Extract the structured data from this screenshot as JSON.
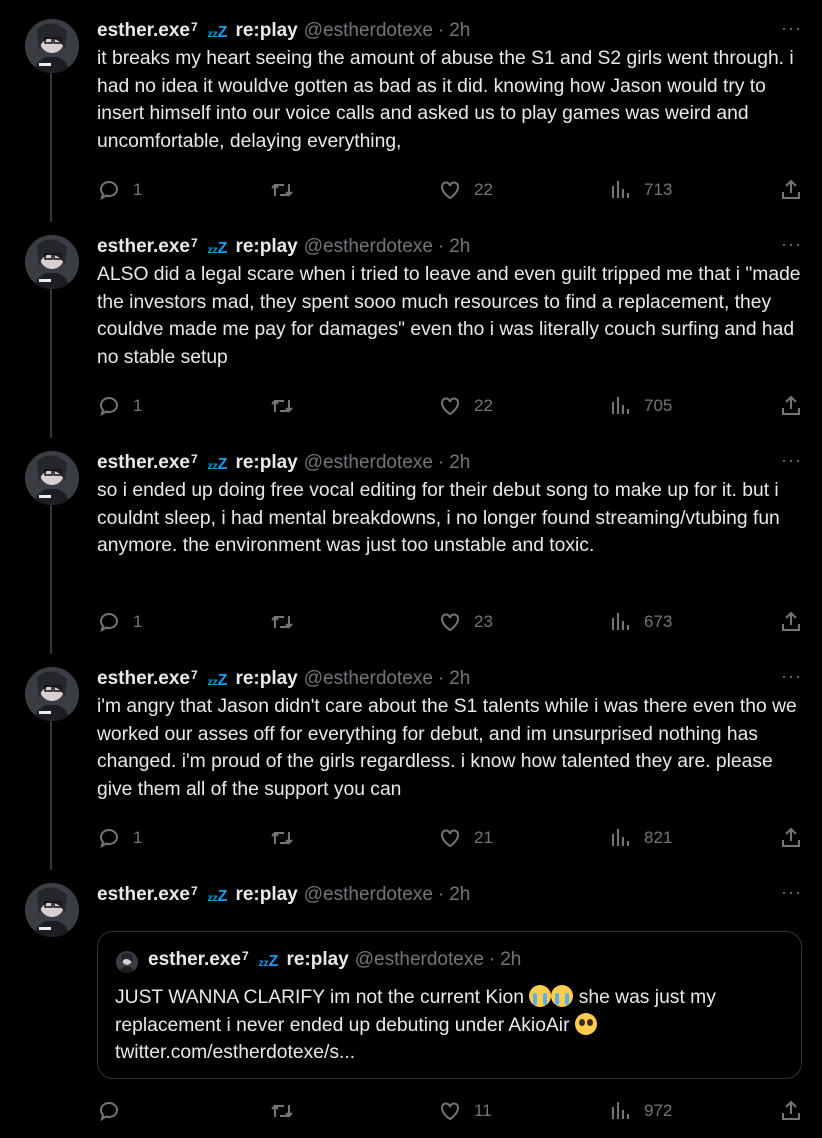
{
  "user": {
    "name": "esther.exe",
    "name_sup": "7",
    "sleep_icon": "zzz-icon",
    "team": "re:play",
    "handle": "@estherdotexe",
    "time": "2h"
  },
  "tweets": [
    {
      "text": "it breaks my heart seeing the amount of abuse the S1 and S2 girls went through. i had no idea it wouldve gotten as bad as it did. knowing how Jason would try to insert himself into our voice calls and asked us to play games was weird and uncomfortable, delaying everything,",
      "replies": "1",
      "likes": "22",
      "views": "713"
    },
    {
      "text": "ALSO did a legal scare when i tried to leave and even guilt tripped me that i \"made the investors mad, they spent sooo much resources to find a replacement, they couldve made me pay for damages\" even tho i was literally couch surfing and had no stable setup",
      "replies": "1",
      "likes": "22",
      "views": "705"
    },
    {
      "text": "so i ended up doing free vocal editing for their debut song to make up for it. but i couldnt sleep, i had mental breakdowns, i no longer found streaming/vtubing fun anymore. the environment was just too unstable and toxic.",
      "replies": "1",
      "likes": "23",
      "views": "673"
    },
    {
      "text": "i'm angry that Jason didn't care about the S1 talents while i was there even tho we worked our asses off for everything for debut, and im unsurprised nothing has changed. i'm proud of the girls regardless. i know how talented they are. please give them all of the support you can",
      "replies": "1",
      "likes": "21",
      "views": "821"
    },
    {
      "text": "",
      "replies": "",
      "likes": "11",
      "views": "972",
      "quote": {
        "part1": "JUST WANNA CLARIFY im not the current Kion",
        "emoji1": "loudly-crying-face",
        "part2": "she was just my replacement i never ended up debuting under AkioAir",
        "emoji2": "pleading-face",
        "link": "twitter.com/estherdotexe/s..."
      }
    }
  ]
}
